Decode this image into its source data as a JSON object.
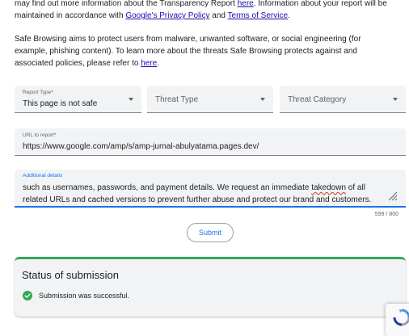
{
  "intro": {
    "p1_text_a": "may find out more information about the Transparency Report ",
    "p1_link_here": "here",
    "p1_text_b": ". Information about your report will be maintained in accordance with ",
    "p1_link_privacy": "Google's Privacy Policy",
    "p1_text_and": " and ",
    "p1_link_tos": "Terms of Service",
    "p1_text_end": ".",
    "p2_text": "Safe Browsing aims to protect users from malware, unwanted software, or social engineering (for example, phishing content). To learn more about the threats Safe Browsing protects against and associated policies, please refer to ",
    "p2_link_here": "here",
    "p2_text_end": "."
  },
  "form": {
    "report_type": {
      "label": "Report Type*",
      "value": "This page is not safe"
    },
    "threat_type": {
      "placeholder": "Threat Type"
    },
    "threat_category": {
      "placeholder": "Threat Category"
    },
    "url": {
      "label": "URL to report*",
      "value": "https://www.google.com/amp/s/amp-jurnal-abulyatama.pages.dev/"
    },
    "details": {
      "label": "Additional details",
      "value_a": "such as usernames, passwords, and payment details. We request an immediate ",
      "value_squiggle": "takedown",
      "value_b": " of all related URLs and cached versions to prevent further abuse and protect our brand and customers.",
      "char_count": "599 / 800"
    },
    "submit_label": "Submit"
  },
  "status": {
    "title": "Status of submission",
    "message": "Submission was successful.",
    "icon": "check-circle-icon",
    "color": "#34a853"
  },
  "colors": {
    "accent": "#1a73e8",
    "link": "#1a0dab",
    "field_bg": "#f1f3f4",
    "success": "#34a853"
  },
  "recaptcha": {
    "icon": "recaptcha-icon"
  }
}
